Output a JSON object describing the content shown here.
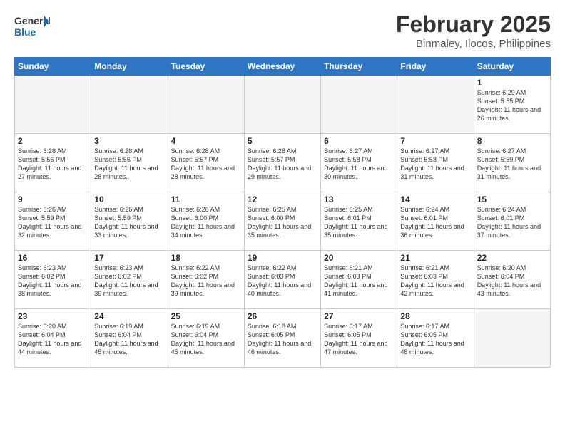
{
  "header": {
    "logo_line1": "General",
    "logo_line2": "Blue",
    "title": "February 2025",
    "subtitle": "Binmaley, Ilocos, Philippines"
  },
  "weekdays": [
    "Sunday",
    "Monday",
    "Tuesday",
    "Wednesday",
    "Thursday",
    "Friday",
    "Saturday"
  ],
  "weeks": [
    [
      {
        "day": "",
        "info": ""
      },
      {
        "day": "",
        "info": ""
      },
      {
        "day": "",
        "info": ""
      },
      {
        "day": "",
        "info": ""
      },
      {
        "day": "",
        "info": ""
      },
      {
        "day": "",
        "info": ""
      },
      {
        "day": "1",
        "info": "Sunrise: 6:29 AM\nSunset: 5:55 PM\nDaylight: 11 hours\nand 26 minutes."
      }
    ],
    [
      {
        "day": "2",
        "info": "Sunrise: 6:28 AM\nSunset: 5:56 PM\nDaylight: 11 hours\nand 27 minutes."
      },
      {
        "day": "3",
        "info": "Sunrise: 6:28 AM\nSunset: 5:56 PM\nDaylight: 11 hours\nand 28 minutes."
      },
      {
        "day": "4",
        "info": "Sunrise: 6:28 AM\nSunset: 5:57 PM\nDaylight: 11 hours\nand 28 minutes."
      },
      {
        "day": "5",
        "info": "Sunrise: 6:28 AM\nSunset: 5:57 PM\nDaylight: 11 hours\nand 29 minutes."
      },
      {
        "day": "6",
        "info": "Sunrise: 6:27 AM\nSunset: 5:58 PM\nDaylight: 11 hours\nand 30 minutes."
      },
      {
        "day": "7",
        "info": "Sunrise: 6:27 AM\nSunset: 5:58 PM\nDaylight: 11 hours\nand 31 minutes."
      },
      {
        "day": "8",
        "info": "Sunrise: 6:27 AM\nSunset: 5:59 PM\nDaylight: 11 hours\nand 31 minutes."
      }
    ],
    [
      {
        "day": "9",
        "info": "Sunrise: 6:26 AM\nSunset: 5:59 PM\nDaylight: 11 hours\nand 32 minutes."
      },
      {
        "day": "10",
        "info": "Sunrise: 6:26 AM\nSunset: 5:59 PM\nDaylight: 11 hours\nand 33 minutes."
      },
      {
        "day": "11",
        "info": "Sunrise: 6:26 AM\nSunset: 6:00 PM\nDaylight: 11 hours\nand 34 minutes."
      },
      {
        "day": "12",
        "info": "Sunrise: 6:25 AM\nSunset: 6:00 PM\nDaylight: 11 hours\nand 35 minutes."
      },
      {
        "day": "13",
        "info": "Sunrise: 6:25 AM\nSunset: 6:01 PM\nDaylight: 11 hours\nand 35 minutes."
      },
      {
        "day": "14",
        "info": "Sunrise: 6:24 AM\nSunset: 6:01 PM\nDaylight: 11 hours\nand 36 minutes."
      },
      {
        "day": "15",
        "info": "Sunrise: 6:24 AM\nSunset: 6:01 PM\nDaylight: 11 hours\nand 37 minutes."
      }
    ],
    [
      {
        "day": "16",
        "info": "Sunrise: 6:23 AM\nSunset: 6:02 PM\nDaylight: 11 hours\nand 38 minutes."
      },
      {
        "day": "17",
        "info": "Sunrise: 6:23 AM\nSunset: 6:02 PM\nDaylight: 11 hours\nand 39 minutes."
      },
      {
        "day": "18",
        "info": "Sunrise: 6:22 AM\nSunset: 6:02 PM\nDaylight: 11 hours\nand 39 minutes."
      },
      {
        "day": "19",
        "info": "Sunrise: 6:22 AM\nSunset: 6:03 PM\nDaylight: 11 hours\nand 40 minutes."
      },
      {
        "day": "20",
        "info": "Sunrise: 6:21 AM\nSunset: 6:03 PM\nDaylight: 11 hours\nand 41 minutes."
      },
      {
        "day": "21",
        "info": "Sunrise: 6:21 AM\nSunset: 6:03 PM\nDaylight: 11 hours\nand 42 minutes."
      },
      {
        "day": "22",
        "info": "Sunrise: 6:20 AM\nSunset: 6:04 PM\nDaylight: 11 hours\nand 43 minutes."
      }
    ],
    [
      {
        "day": "23",
        "info": "Sunrise: 6:20 AM\nSunset: 6:04 PM\nDaylight: 11 hours\nand 44 minutes."
      },
      {
        "day": "24",
        "info": "Sunrise: 6:19 AM\nSunset: 6:04 PM\nDaylight: 11 hours\nand 45 minutes."
      },
      {
        "day": "25",
        "info": "Sunrise: 6:19 AM\nSunset: 6:04 PM\nDaylight: 11 hours\nand 45 minutes."
      },
      {
        "day": "26",
        "info": "Sunrise: 6:18 AM\nSunset: 6:05 PM\nDaylight: 11 hours\nand 46 minutes."
      },
      {
        "day": "27",
        "info": "Sunrise: 6:17 AM\nSunset: 6:05 PM\nDaylight: 11 hours\nand 47 minutes."
      },
      {
        "day": "28",
        "info": "Sunrise: 6:17 AM\nSunset: 6:05 PM\nDaylight: 11 hours\nand 48 minutes."
      },
      {
        "day": "",
        "info": ""
      }
    ]
  ]
}
